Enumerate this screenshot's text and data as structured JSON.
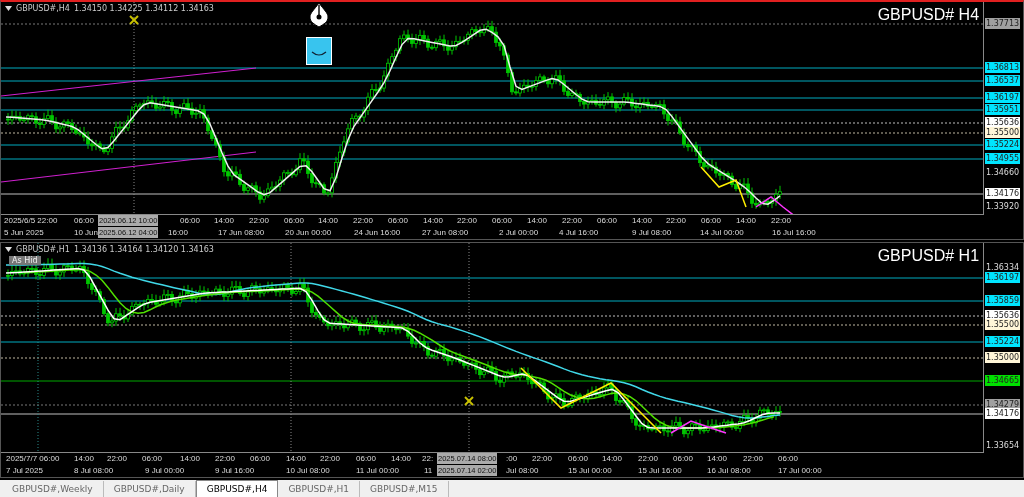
{
  "panels": [
    {
      "symbol": "GBPUSD#,H4",
      "ohlc": "1.34150 1.34225 1.34112 1.34163",
      "title": "GBPUSD# H4",
      "active": true,
      "price_labels": [
        {
          "text": "1.37713",
          "kind": "dotted-line",
          "color": "#a0a0a0"
        },
        {
          "text": "1.36813",
          "kind": "solid-line",
          "color": "#00e5ff"
        },
        {
          "text": "1.36537",
          "kind": "solid-line",
          "color": "#00e5ff"
        },
        {
          "text": "1.36197",
          "kind": "solid-line",
          "color": "#00e5ff"
        },
        {
          "text": "1.35951",
          "kind": "solid-line",
          "color": "#00e5ff"
        },
        {
          "text": "1.35636",
          "kind": "dotted-line",
          "color": "#ffffff"
        },
        {
          "text": "1.35500",
          "kind": "dotted-line",
          "color": "#fff6d8"
        },
        {
          "text": "1.35224",
          "kind": "solid-line",
          "color": "#00e5ff"
        },
        {
          "text": "1.34955",
          "kind": "solid-line",
          "color": "#00e5ff"
        },
        {
          "text": "1.34660",
          "kind": "plain"
        },
        {
          "text": "1.34176",
          "kind": "solid-line",
          "color": "#ffffff"
        },
        {
          "text": "1.33920",
          "kind": "plain"
        }
      ],
      "time_row_1": [
        {
          "text": "2025/6/5 22:00"
        },
        {
          "text": "06:00"
        },
        {
          "text": "2025.06.12 10:00",
          "kind": "cursor"
        },
        {
          "text": "06:00"
        },
        {
          "text": "14:00"
        },
        {
          "text": "22:00"
        },
        {
          "text": "06:00"
        },
        {
          "text": "14:00"
        },
        {
          "text": "22:00"
        },
        {
          "text": "06:00"
        },
        {
          "text": "14:00"
        },
        {
          "text": "22:00"
        },
        {
          "text": "06:00"
        },
        {
          "text": "14:00"
        },
        {
          "text": "22:00"
        },
        {
          "text": "06:00"
        },
        {
          "text": "14:00"
        },
        {
          "text": "22:00"
        },
        {
          "text": "06:00"
        },
        {
          "text": "14:00"
        },
        {
          "text": "22:00"
        }
      ],
      "time_row_2": [
        {
          "text": "5 Jun 2025"
        },
        {
          "text": "10 Jun"
        },
        {
          "text": "2025.06.12 04:00",
          "kind": "cursor"
        },
        {
          "text": "16:00"
        },
        {
          "text": "17 Jun 08:00"
        },
        {
          "text": "20 Jun 00:00"
        },
        {
          "text": "24 Jun 16:00"
        },
        {
          "text": "27 Jun 08:00"
        },
        {
          "text": "2 Jul 00:00"
        },
        {
          "text": "4 Jul 16:00"
        },
        {
          "text": "9 Jul 08:00"
        },
        {
          "text": "14 Jul 00:00"
        },
        {
          "text": "16 Jul 16:00"
        }
      ]
    },
    {
      "symbol": "GBPUSD#,H1",
      "ohlc": "1.34136 1.34164 1.34120 1.34163",
      "title": "GBPUSD# H1",
      "active": false,
      "tag": "As Hid",
      "price_labels": [
        {
          "text": "1.36334",
          "kind": "plain"
        },
        {
          "text": "1.36197",
          "kind": "solid-line",
          "color": "#00e5ff"
        },
        {
          "text": "1.35859",
          "kind": "solid-line",
          "color": "#00e5ff"
        },
        {
          "text": "1.35636",
          "kind": "dotted-line",
          "color": "#ffffff"
        },
        {
          "text": "1.35500",
          "kind": "dotted-line",
          "color": "#fff6d8"
        },
        {
          "text": "1.35224",
          "kind": "solid-line",
          "color": "#00e5ff"
        },
        {
          "text": "1.35000",
          "kind": "dotted-line",
          "color": "#fff6d8"
        },
        {
          "text": "1.34665",
          "kind": "solid-line",
          "color": "#00e000"
        },
        {
          "text": "1.34279",
          "kind": "dotted-line",
          "color": "#a0a0a0"
        },
        {
          "text": "1.34176",
          "kind": "solid-line",
          "color": "#ffffff"
        },
        {
          "text": "1.33654",
          "kind": "plain"
        }
      ],
      "time_row_1": [
        {
          "text": "2025/7/7 06:00"
        },
        {
          "text": "14:00"
        },
        {
          "text": "22:00"
        },
        {
          "text": "06:00"
        },
        {
          "text": "14:00"
        },
        {
          "text": "22:00"
        },
        {
          "text": "06:00"
        },
        {
          "text": "14:00"
        },
        {
          "text": "22:00"
        },
        {
          "text": "06:00"
        },
        {
          "text": "14:00"
        },
        {
          "text": "22:"
        },
        {
          "text": "2025.07.14 08:00",
          "kind": "cursor"
        },
        {
          "text": ":00"
        },
        {
          "text": "22:00"
        },
        {
          "text": "06:00"
        },
        {
          "text": "14:00"
        },
        {
          "text": "22:00"
        },
        {
          "text": "06:00"
        },
        {
          "text": "14:00"
        },
        {
          "text": "22:00"
        },
        {
          "text": "06:00"
        }
      ],
      "time_row_2": [
        {
          "text": "7 Jul 2025"
        },
        {
          "text": "8 Jul 08:00"
        },
        {
          "text": "9 Jul 00:00"
        },
        {
          "text": "9 Jul 16:00"
        },
        {
          "text": "10 Jul 08:00"
        },
        {
          "text": "11 Jul 00:00"
        },
        {
          "text": "11"
        },
        {
          "text": "2025.07.14 02:00",
          "kind": "cursor"
        },
        {
          "text": "Jul 08:00"
        },
        {
          "text": "15 Jul 00:00"
        },
        {
          "text": "15 Jul 16:00"
        },
        {
          "text": "16 Jul 08:00"
        },
        {
          "text": "17 Jul 00:00"
        }
      ]
    }
  ],
  "tabs": [
    {
      "label": "GBPUSD#,Weekly",
      "selected": false
    },
    {
      "label": "GBPUSD#,Daily",
      "selected": false
    },
    {
      "label": "GBPUSD#,H4",
      "selected": true
    },
    {
      "label": "GBPUSD#,H1",
      "selected": false
    },
    {
      "label": "GBPUSD#,M15",
      "selected": false
    }
  ]
}
